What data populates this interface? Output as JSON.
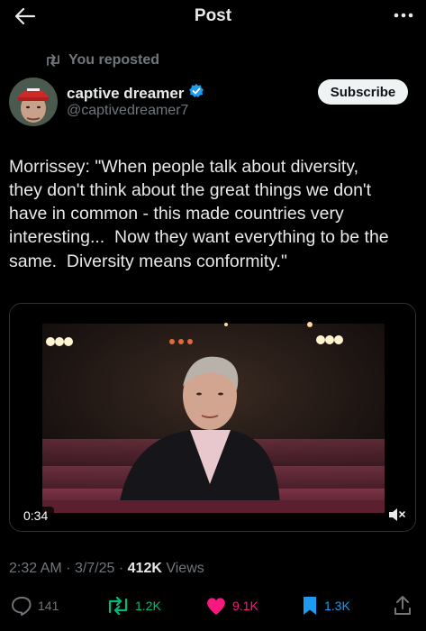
{
  "header": {
    "title": "Post"
  },
  "repost": {
    "text": "You reposted"
  },
  "author": {
    "display_name": "captive dreamer",
    "handle": "@captivedreamer7",
    "subscribe_label": "Subscribe",
    "verified_color": "#1d9bf0"
  },
  "post": {
    "text": "Morrissey: \"When people talk about diversity,\nthey don't think about the great things we don't\nhave in common - this made countries very\ninteresting...  Now they want everything to be the\nsame.  Diversity means conformity.\""
  },
  "video": {
    "duration": "0:34"
  },
  "meta": {
    "time": "2:32 AM",
    "date": "3/7/25",
    "views_count": "412K",
    "views_label": "Views"
  },
  "actions": {
    "replies": "141",
    "reposts": "1.2K",
    "likes": "9.1K",
    "bookmarks": "1.3K"
  },
  "colors": {
    "repost": "#00ba7c",
    "like": "#f91880",
    "bookmark": "#1d9bf0",
    "muted": "#71767b"
  }
}
